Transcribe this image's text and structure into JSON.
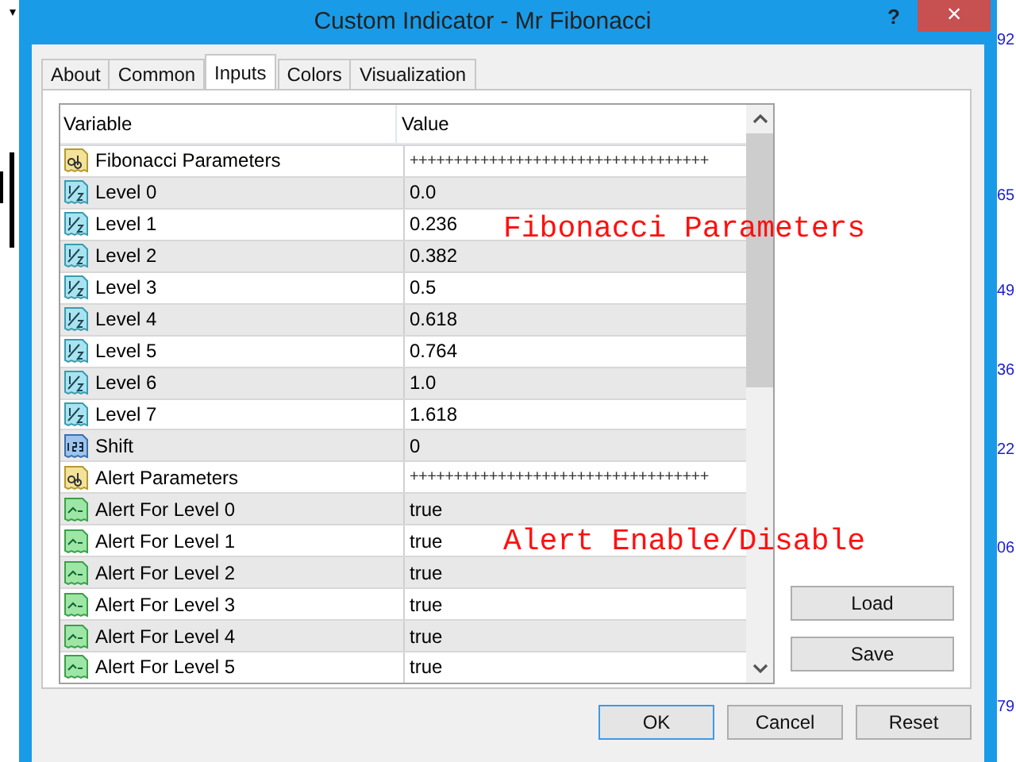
{
  "window": {
    "title": "Custom Indicator - Mr Fibonacci",
    "help": "?",
    "close": "×"
  },
  "tabs": [
    {
      "label": "About",
      "selected": false
    },
    {
      "label": "Common",
      "selected": false
    },
    {
      "label": "Inputs",
      "selected": true
    },
    {
      "label": "Colors",
      "selected": false
    },
    {
      "label": "Visualization",
      "selected": false
    }
  ],
  "table": {
    "columns": [
      "Variable",
      "Value"
    ],
    "rows": [
      {
        "kind": "string",
        "variable": "Fibonacci Parameters",
        "value": "++++++++++++++++++++++++++++++++++"
      },
      {
        "kind": "double",
        "variable": "Level 0",
        "value": "0.0"
      },
      {
        "kind": "double",
        "variable": "Level 1",
        "value": "0.236"
      },
      {
        "kind": "double",
        "variable": "Level 2",
        "value": "0.382"
      },
      {
        "kind": "double",
        "variable": "Level 3",
        "value": "0.5"
      },
      {
        "kind": "double",
        "variable": "Level 4",
        "value": "0.618"
      },
      {
        "kind": "double",
        "variable": "Level 5",
        "value": "0.764"
      },
      {
        "kind": "double",
        "variable": "Level 6",
        "value": "1.0"
      },
      {
        "kind": "double",
        "variable": "Level 7",
        "value": "1.618"
      },
      {
        "kind": "integer",
        "variable": "Shift",
        "value": "0"
      },
      {
        "kind": "string",
        "variable": "Alert Parameters",
        "value": "++++++++++++++++++++++++++++++++++"
      },
      {
        "kind": "bool",
        "variable": "Alert For Level 0",
        "value": "true"
      },
      {
        "kind": "bool",
        "variable": "Alert For Level 1",
        "value": "true"
      },
      {
        "kind": "bool",
        "variable": "Alert For Level 2",
        "value": "true"
      },
      {
        "kind": "bool",
        "variable": "Alert For Level 3",
        "value": "true"
      },
      {
        "kind": "bool",
        "variable": "Alert For Level 4",
        "value": "true"
      },
      {
        "kind": "bool",
        "variable": "Alert For Level 5",
        "value": "true"
      }
    ]
  },
  "annotations": [
    "Fibonacci Parameters",
    "Alert Enable/Disable"
  ],
  "side_buttons": [
    "Load",
    "Save"
  ],
  "buttons": [
    {
      "label": "OK",
      "default": true
    },
    {
      "label": "Cancel",
      "default": false
    },
    {
      "label": "Reset",
      "default": false
    }
  ],
  "price_labels": [
    "92",
    "65",
    "49",
    "36",
    "22",
    "06",
    "79"
  ]
}
